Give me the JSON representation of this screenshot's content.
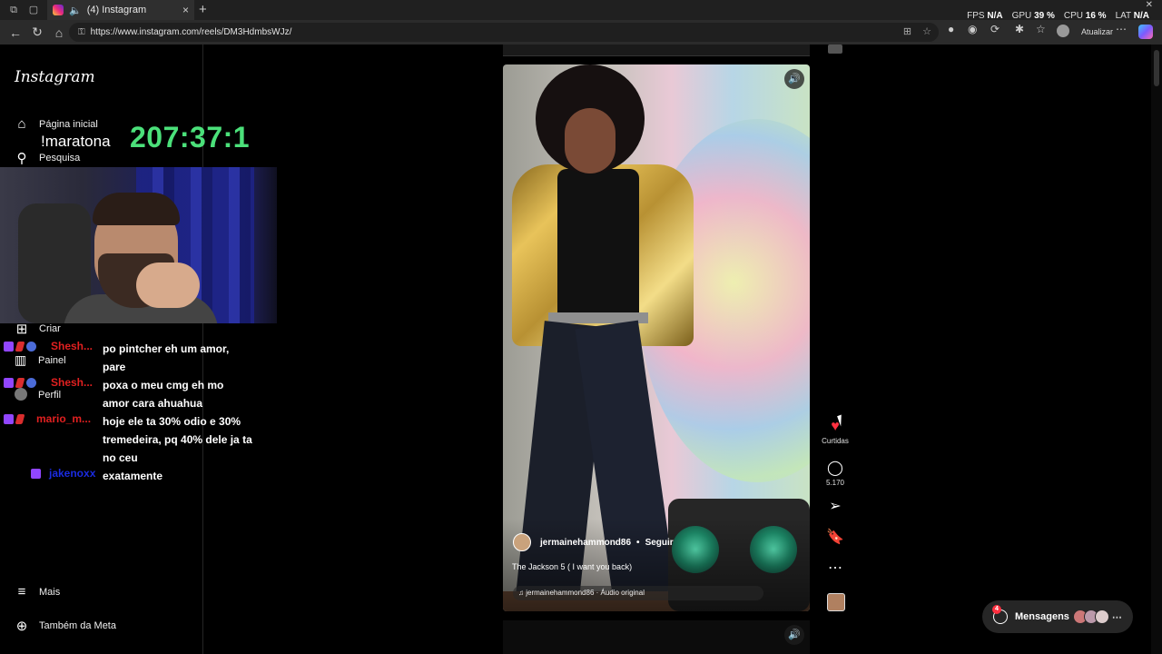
{
  "browser": {
    "tab_title": "(4) Instagram",
    "url": "https://www.instagram.com/reels/DM3HdmbsWJz/",
    "update_label": "Atualizar",
    "perf": {
      "fps_label": "FPS",
      "fps_value": "N/A",
      "gpu_label": "GPU",
      "gpu_value": "39 %",
      "cpu_label": "CPU",
      "cpu_value": "16 %",
      "lat_label": "LAT",
      "lat_value": "N/A"
    }
  },
  "sidebar": {
    "logo": "Instagram",
    "home": "Página inicial",
    "search": "Pesquisa",
    "create": "Criar",
    "dashboard": "Painel",
    "profile": "Perfil",
    "more": "Mais",
    "meta": "Também da Meta"
  },
  "overlay": {
    "marathon_label": "!maratona",
    "timer": "207:37:1"
  },
  "chat": [
    {
      "user": "Shesh...",
      "user_color": "#e02020",
      "message": "po pintcher eh um amor, pare"
    },
    {
      "user": "Shesh...",
      "user_color": "#e02020",
      "message": "poxa o meu cmg eh mo amor cara ahuahua"
    },
    {
      "user": "mario_m...",
      "user_color": "#e02020",
      "message": "hoje ele ta 30% odio e 30% tremedeira, pq 40% dele ja ta no ceu"
    },
    {
      "user": "jakenoxx",
      "user_color": "#1a2be0",
      "message": "exatamente"
    }
  ],
  "reel": {
    "author": "jermainehammond86",
    "follow": "Seguir",
    "caption": "The Jackson 5 ( I want you back)",
    "audio": "jermainehammond86 · Áudio original",
    "likes_label": "Curtidas",
    "comments_count": "5.170"
  },
  "messages": {
    "label": "Mensagens",
    "unread": "4"
  },
  "colors": {
    "timer": "#4be07a",
    "like": "#ff3040",
    "twitch": "#9146ff"
  }
}
